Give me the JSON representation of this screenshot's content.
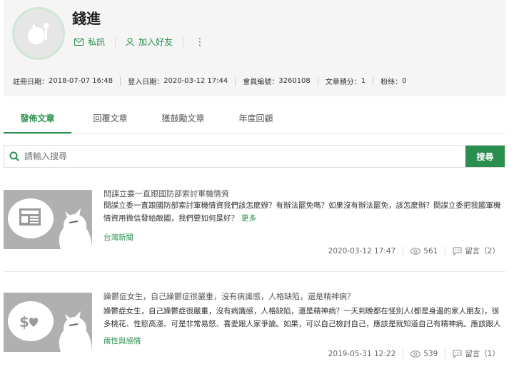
{
  "profile": {
    "name": "錢進",
    "message_label": "私訊",
    "add_friend_label": "加入好友",
    "more_label": "⋮"
  },
  "stats": [
    {
      "label": "註冊日期：",
      "value": "2018-07-07 16:48"
    },
    {
      "label": "登入日期：",
      "value": "2020-03-12 17:44"
    },
    {
      "label": "會員編號：",
      "value": "3260108"
    },
    {
      "label": "文章積分：",
      "value": "1"
    },
    {
      "label": "粉絲：",
      "value": "0"
    }
  ],
  "tabs": [
    {
      "label": "發佈文章",
      "active": true
    },
    {
      "label": "回覆文章",
      "active": false
    },
    {
      "label": "獲鼓勵文章",
      "active": false
    },
    {
      "label": "年度回顧",
      "active": false
    }
  ],
  "search": {
    "placeholder": "請輸入搜尋",
    "button_label": "搜尋"
  },
  "posts": [
    {
      "title": "間諜立委一直跟國防部索討軍機情資",
      "excerpt": "間諜立委一直跟國防部索討軍機情資我們該怎麼辦？有辦法罷免嗎？如果沒有辦法罷免，該怎麼辦？間諜立委把我國軍機情資用微信發給敵國，我們要如何是好？",
      "more_label": "更多",
      "board": "台灣新聞",
      "date": "2020-03-12 17:47",
      "views": "561",
      "comments_label": "留言（2）"
    },
    {
      "title": "躁鬱症女生，自己躁鬱症很嚴重，沒有病識感，人格缺陷，還是精神病？",
      "excerpt": "躁鬱症女生，自己躁鬱症很嚴重，沒有病識感，人格缺陷，還是精神病？一天到晚都在怪別人(都是身邊的家人朋友)，很多桃花、性慾高漲、可是非常易怒、喜愛跟人家爭論。如果，可以自己檢討自己，應該是就知道自己有精神病。應該跟人格還是齊洛",
      "board": "兩性與感情",
      "date": "2019-05-31 12:22",
      "views": "539",
      "comments_label": "留言（1）"
    }
  ],
  "colors": {
    "accent": "#2a8f4e",
    "thumb_bg": "#b0b0b0"
  }
}
